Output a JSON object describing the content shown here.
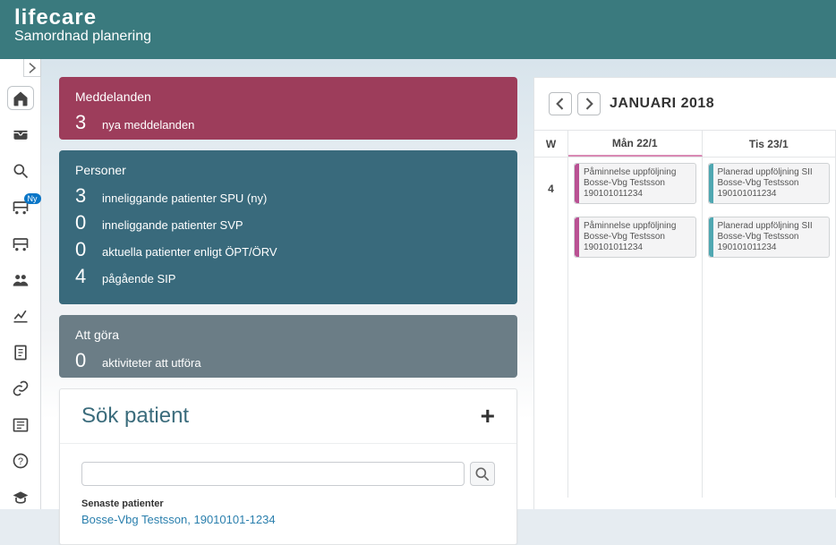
{
  "brand": {
    "logo": "lifecare",
    "subtitle": "Samordnad planering"
  },
  "sidebar_badge": "Ny",
  "cards": {
    "messages": {
      "title": "Meddelanden",
      "count": "3",
      "label": "nya meddelanden"
    },
    "persons": {
      "title": "Personer",
      "items": [
        {
          "count": "3",
          "label": "inneliggande patienter SPU (ny)"
        },
        {
          "count": "0",
          "label": "inneliggande patienter SVP"
        },
        {
          "count": "0",
          "label": "aktuella patienter enligt ÖPT/ÖRV"
        },
        {
          "count": "4",
          "label": "pågående SIP"
        }
      ]
    },
    "todo": {
      "title": "Att göra",
      "count": "0",
      "label": "aktiviteter att utföra"
    }
  },
  "search": {
    "heading": "Sök patient",
    "placeholder": "",
    "recent_label": "Senaste patienter",
    "recent_link": "Bosse-Vbg Testsson, 19010101-1234"
  },
  "calendar": {
    "month": "JANUARI 2018",
    "week_header": "W",
    "week": "4",
    "days": [
      {
        "label": "Mån 22/1",
        "events": [
          {
            "color": "pink",
            "title": "Påminnelse uppföljning",
            "name": "Bosse-Vbg Testsson",
            "id": "190101011234"
          },
          {
            "color": "pink",
            "title": "Påminnelse uppföljning",
            "name": "Bosse-Vbg Testsson",
            "id": "190101011234"
          }
        ]
      },
      {
        "label": "Tis 23/1",
        "events": [
          {
            "color": "teal",
            "title": "Planerad uppföljning SII",
            "name": "Bosse-Vbg Testsson",
            "id": "190101011234"
          },
          {
            "color": "teal",
            "title": "Planerad uppföljning SII",
            "name": "Bosse-Vbg Testsson",
            "id": "190101011234"
          }
        ]
      }
    ]
  }
}
